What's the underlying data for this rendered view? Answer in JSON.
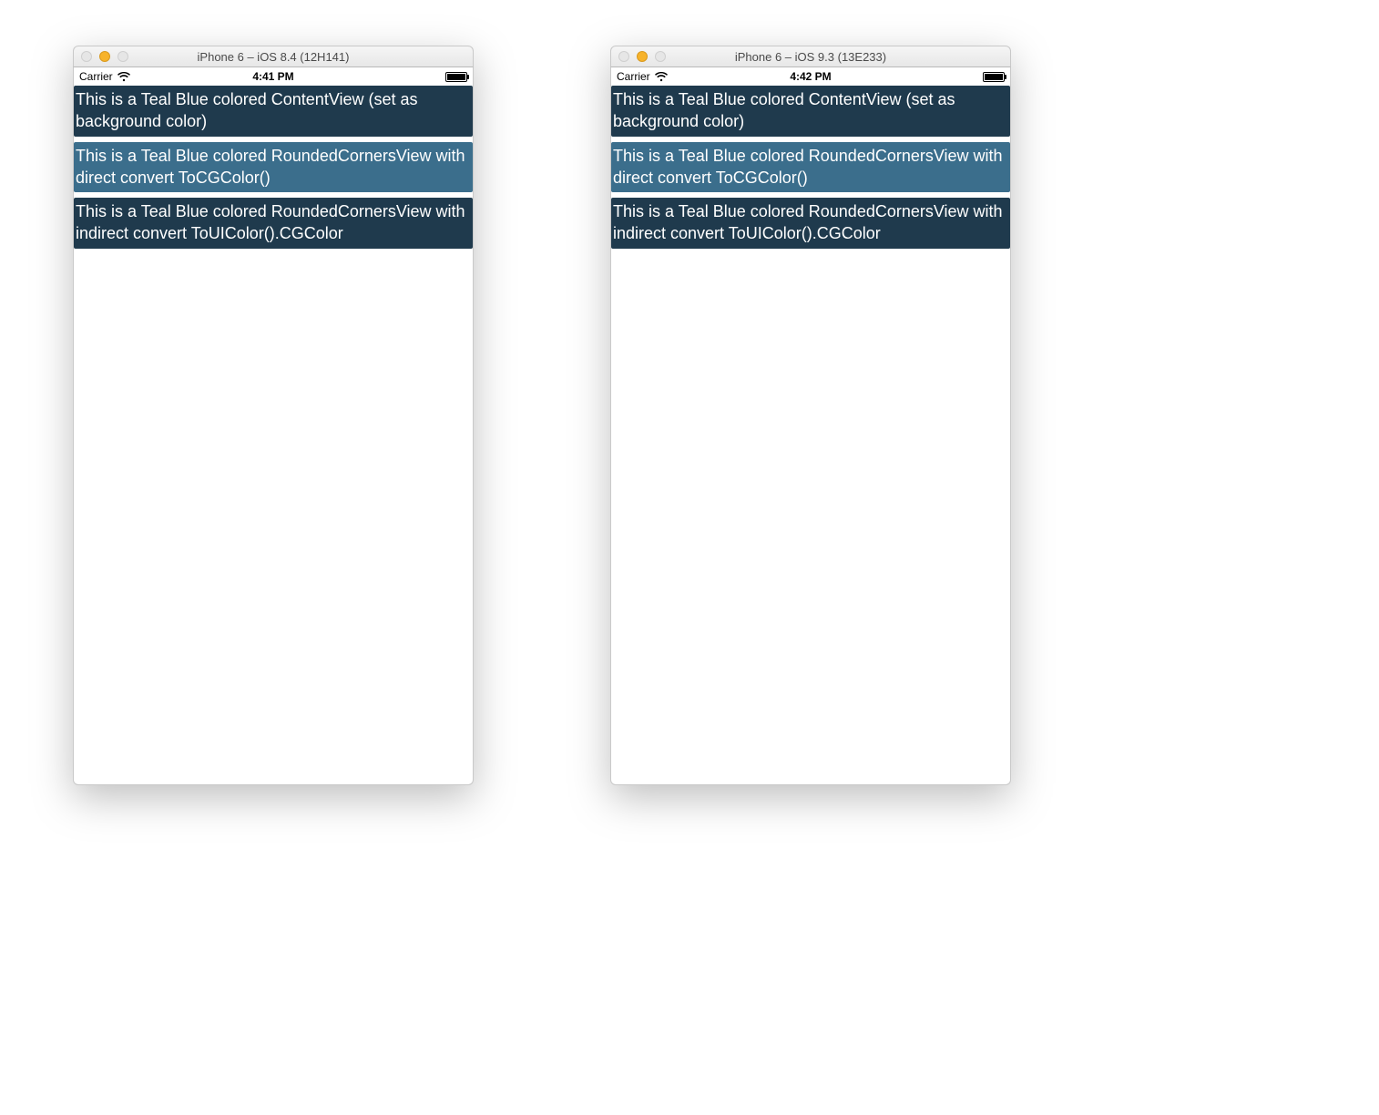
{
  "colors": {
    "cell_dark": "#1f3a4d",
    "cell_lite": "#3b6e8c"
  },
  "simulators": [
    {
      "window_title": "iPhone 6 – iOS 8.4 (12H141)",
      "statusbar": {
        "carrier": "Carrier",
        "time": "4:41 PM"
      },
      "cells": [
        {
          "text": "This is a Teal Blue colored ContentView (set as background color)",
          "tone": "dark"
        },
        {
          "text": "This is a Teal Blue colored RoundedCornersView with direct convert ToCGColor()",
          "tone": "lite"
        },
        {
          "text": "This is a Teal Blue colored RoundedCornersView with indirect convert ToUIColor().CGColor",
          "tone": "dark"
        }
      ]
    },
    {
      "window_title": "iPhone 6 – iOS 9.3 (13E233)",
      "statusbar": {
        "carrier": "Carrier",
        "time": "4:42 PM"
      },
      "cells": [
        {
          "text": "This is a Teal Blue colored ContentView (set as background color)",
          "tone": "dark"
        },
        {
          "text": "This is a Teal Blue colored RoundedCornersView with direct convert ToCGColor()",
          "tone": "lite"
        },
        {
          "text": "This is a Teal Blue colored RoundedCornersView with indirect convert ToUIColor().CGColor",
          "tone": "dark"
        }
      ]
    }
  ]
}
